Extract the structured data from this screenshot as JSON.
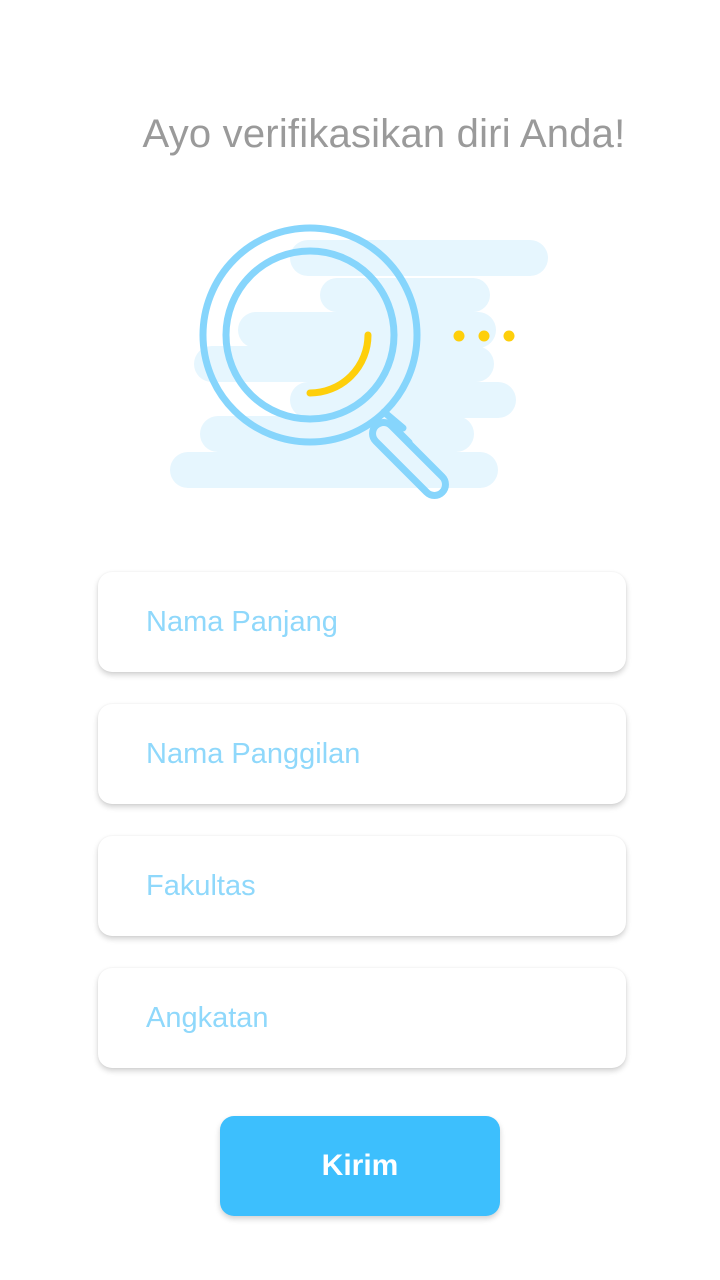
{
  "header": {
    "title": "Ayo verifikasikan diri Anda!"
  },
  "illustration": {
    "icon": "magnifying-glass-icon",
    "colors": {
      "cloud": "#e6f6fe",
      "lens": "#86d5fc",
      "accent": "#fecf0b"
    }
  },
  "form": {
    "fields": [
      {
        "placeholder": "Nama Panjang",
        "value": ""
      },
      {
        "placeholder": "Nama Panggilan",
        "value": ""
      },
      {
        "placeholder": "Fakultas",
        "value": ""
      },
      {
        "placeholder": "Angkatan",
        "value": ""
      }
    ],
    "submit_label": "Kirim"
  },
  "colors": {
    "primary": "#3dbffd",
    "placeholder": "#8fd8fb",
    "title": "#9a9a9a"
  }
}
